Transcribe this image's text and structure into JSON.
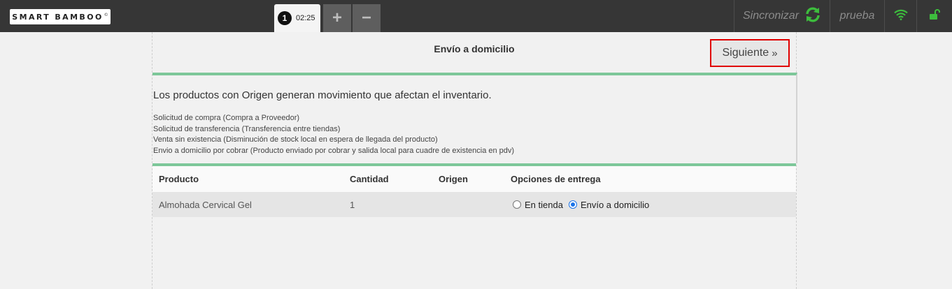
{
  "brand": {
    "logo_text": "SMART BAMBOO",
    "logo_mark": "©"
  },
  "tabs": {
    "ticket_number": "1",
    "ticket_time": "02:25",
    "add_label": "+",
    "remove_label": "−"
  },
  "header_right": {
    "sync_label": "Sincronizar",
    "user_label": "prueba"
  },
  "icons": {
    "sync": "sync-icon",
    "wifi": "wifi-icon",
    "lock": "unlock-icon"
  },
  "colors": {
    "accent_green": "#7dc799",
    "icon_green": "#3dbd3d",
    "highlight_red": "#e00000",
    "radio_blue": "#1a73e8"
  },
  "panel": {
    "title": "Envío a domicilio",
    "next_label": "Siguiente",
    "next_chevron": "»",
    "info_main": "Los productos con Origen generan movimiento que afectan el inventario.",
    "info_list": [
      "Solicitud de compra (Compra a Proveedor)",
      "Solicitud de transferencia (Transferencia entre tiendas)",
      "Venta sin existencia (Disminución de stock local en espera de llegada del producto)",
      "Envio a domicilio por cobrar (Producto enviado por cobrar y salida local para cuadre de existencia en pdv)"
    ]
  },
  "table": {
    "headers": [
      "Producto",
      "Cantidad",
      "Origen",
      "Opciones de entrega"
    ],
    "rows": [
      {
        "producto": "Almohada Cervical Gel",
        "cantidad": "1",
        "origen": "",
        "options": [
          "En tienda",
          "Envío a domicilio"
        ],
        "selected": "Envío a domicilio"
      }
    ]
  }
}
